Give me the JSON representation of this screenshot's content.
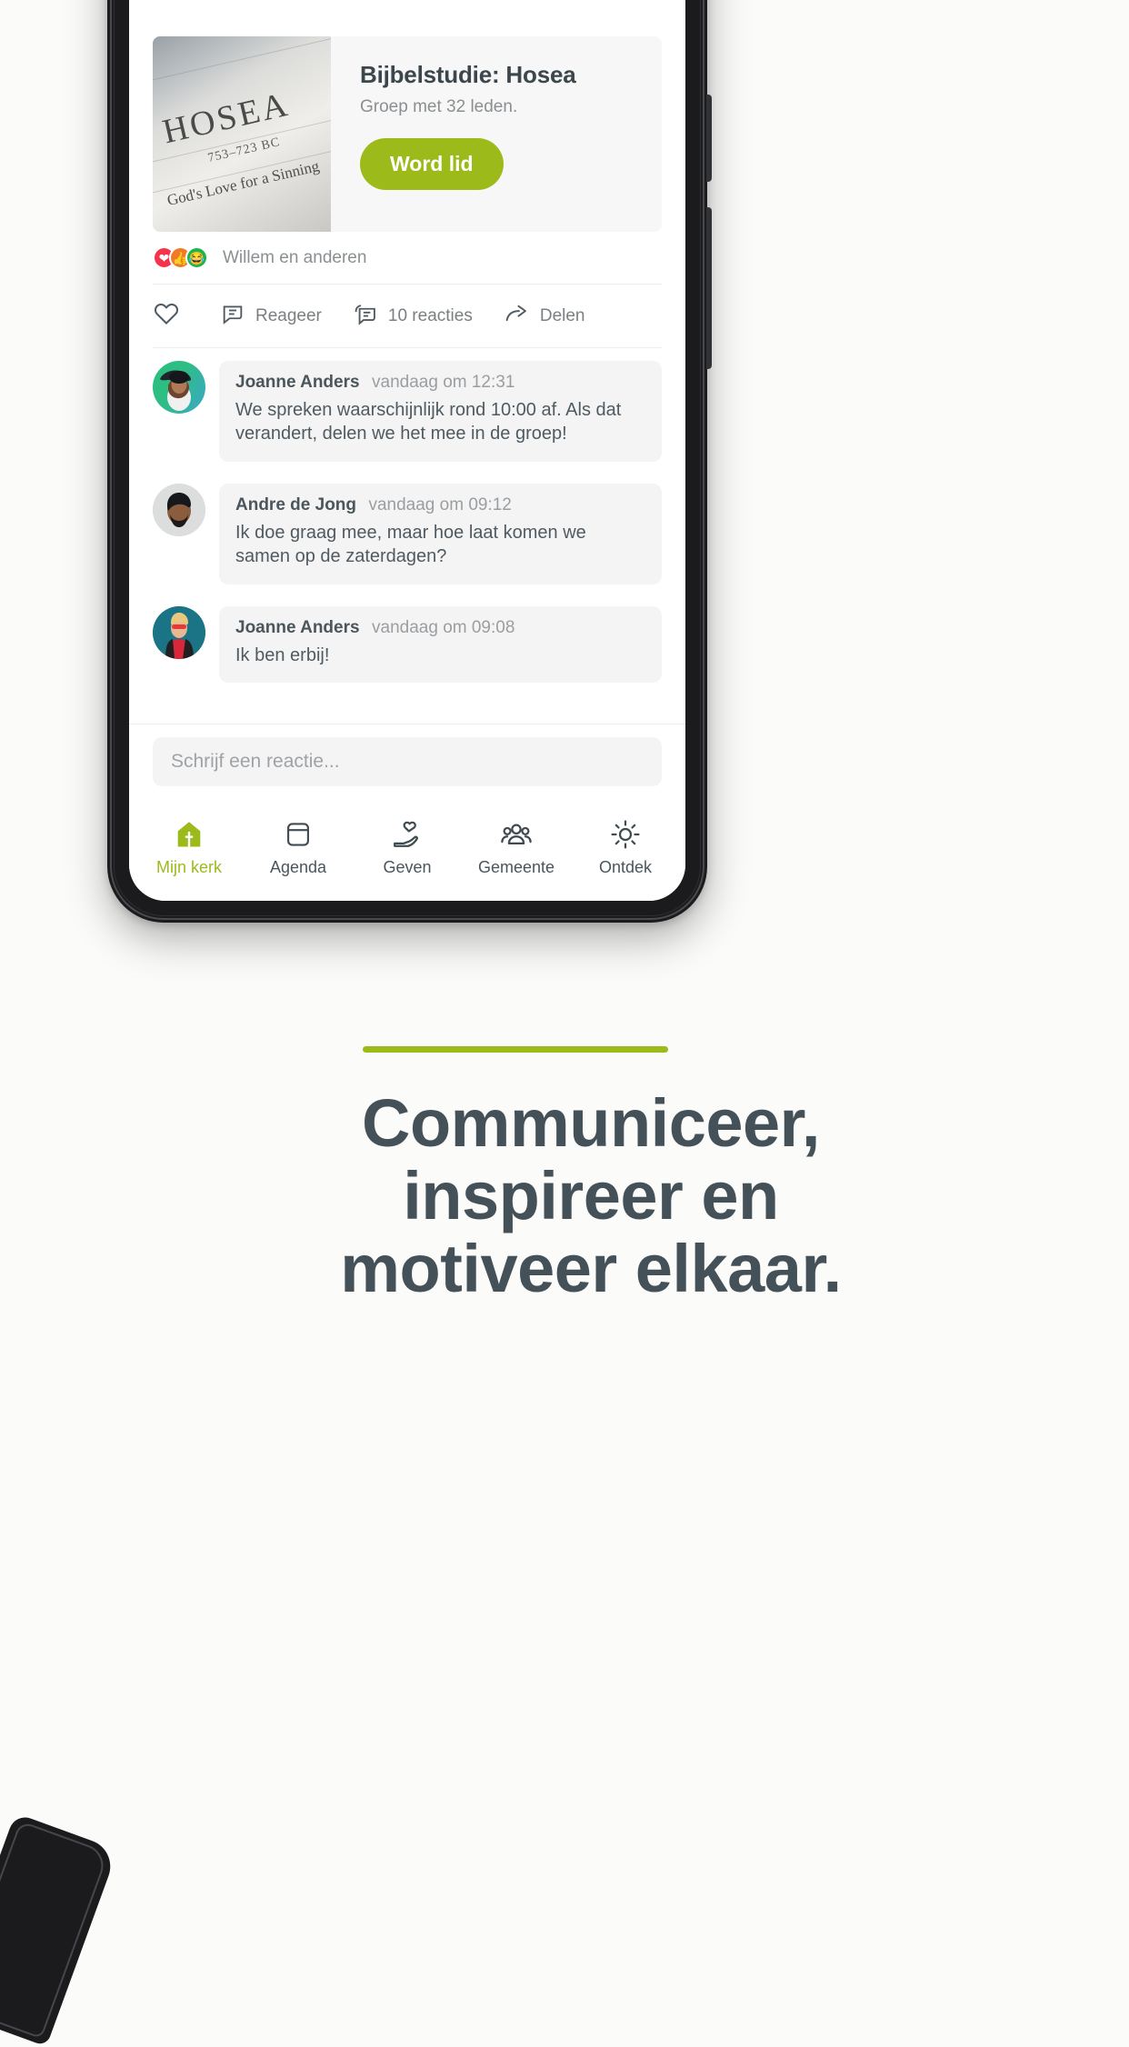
{
  "group_card": {
    "title": "Bijbelstudie: Hosea",
    "subtitle": "Groep met 32 leden.",
    "join_label": "Word lid",
    "thumbnail": {
      "book_title": "HOSEA",
      "dates": "753–723 BC",
      "caption": "God's Love for a Sinning"
    }
  },
  "reactions": {
    "names": "Willem en anderen",
    "emojis": [
      "love-reaction",
      "like-reaction",
      "haha-reaction"
    ]
  },
  "actions": {
    "like": {
      "label": "",
      "icon": "heart-icon"
    },
    "comment": {
      "label": "Reageer",
      "icon": "comment-icon"
    },
    "comments_count": {
      "label": "10 reacties",
      "icon": "comments-stack-icon"
    },
    "share": {
      "label": "Delen",
      "icon": "share-icon"
    }
  },
  "comments": [
    {
      "author": "Joanne Anders",
      "time": "vandaag om 12:31",
      "text": "We spreken waarschijnlijk rond 10:00 af. Als dat verandert, delen we het mee in de groep!",
      "avatar": "woman-with-hat-avatar"
    },
    {
      "author": "Andre de Jong",
      "time": "vandaag om 09:12",
      "text": "Ik doe graag mee, maar hoe laat komen we samen op de zaterdagen?",
      "avatar": "bearded-man-avatar"
    },
    {
      "author": "Joanne Anders",
      "time": "vandaag om 09:08",
      "text": "Ik ben erbij!",
      "avatar": "woman-sunglasses-avatar"
    }
  ],
  "composer": {
    "placeholder": "Schrijf een reactie...",
    "value": ""
  },
  "bottom_nav": [
    {
      "label": "Mijn kerk",
      "icon": "church-icon",
      "active": true
    },
    {
      "label": "Agenda",
      "icon": "calendar-icon",
      "active": false
    },
    {
      "label": "Geven",
      "icon": "hand-heart-icon",
      "active": false
    },
    {
      "label": "Gemeente",
      "icon": "people-icon",
      "active": false
    },
    {
      "label": "Ontdek",
      "icon": "sun-icon",
      "active": false
    }
  ],
  "marketing": {
    "headline_line1": "Communiceer,",
    "headline_line2": "inspireer en",
    "headline_line3": "motiveer elkaar."
  },
  "colors": {
    "accent_green": "#9dba1b",
    "text_dark": "#455158",
    "text_muted": "#8b8f91",
    "bubble_bg": "#f4f4f5"
  }
}
